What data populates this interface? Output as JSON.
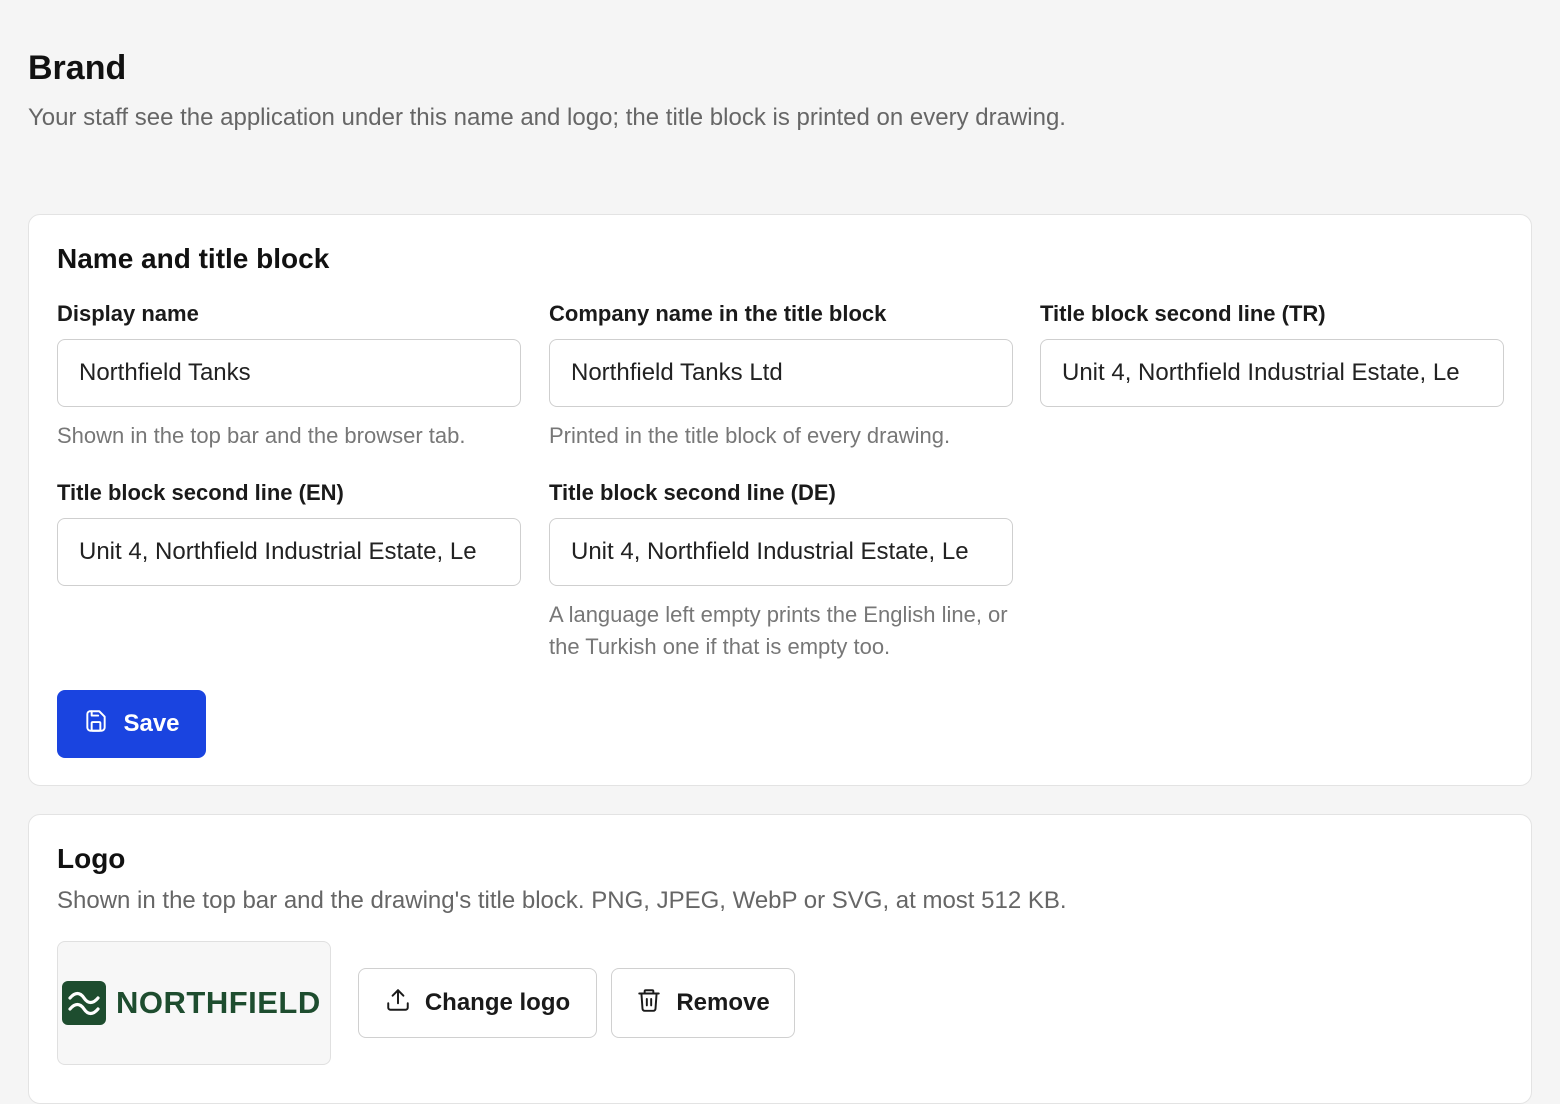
{
  "page": {
    "title": "Brand",
    "description": "Your staff see the application under this name and logo; the title block is printed on every drawing."
  },
  "name_card": {
    "title": "Name and title block",
    "fields": {
      "display_name": {
        "label": "Display name",
        "value": "Northfield Tanks",
        "help": "Shown in the top bar and the browser tab."
      },
      "company_name": {
        "label": "Company name in the title block",
        "value": "Northfield Tanks Ltd",
        "help": "Printed in the title block of every drawing."
      },
      "second_line_tr": {
        "label": "Title block second line (TR)",
        "value": "Unit 4, Northfield Industrial Estate, Le"
      },
      "second_line_en": {
        "label": "Title block second line (EN)",
        "value": "Unit 4, Northfield Industrial Estate, Le"
      },
      "second_line_de": {
        "label": "Title block second line (DE)",
        "value": "Unit 4, Northfield Industrial Estate, Le",
        "help": "A language left empty prints the English line, or the Turkish one if that is empty too."
      }
    },
    "save_label": "Save",
    "save_icon": "save-icon"
  },
  "logo_card": {
    "title": "Logo",
    "description": "Shown in the top bar and the drawing's title block. PNG, JPEG, WebP or SVG, at most 512 KB.",
    "logo_text": "NORTHFIELD",
    "logo_icon": "waves-icon",
    "change_label": "Change logo",
    "change_icon": "upload-icon",
    "remove_label": "Remove",
    "remove_icon": "trash-icon"
  },
  "colors": {
    "accent": "#1a44e0",
    "logo_green": "#1e4d2f",
    "background": "#f5f5f5"
  }
}
